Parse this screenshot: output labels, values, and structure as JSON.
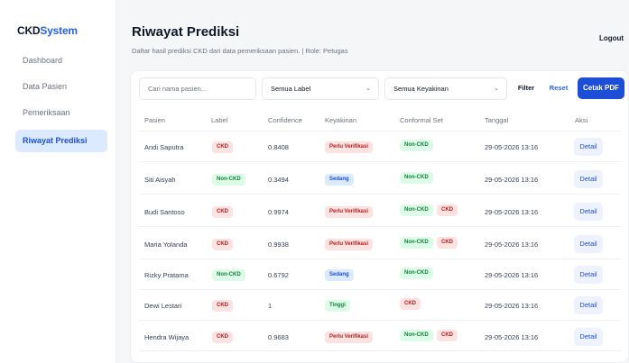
{
  "brand": {
    "part1": "CKD",
    "part2": "System"
  },
  "sidebar": {
    "items": [
      {
        "label": "Dashboard"
      },
      {
        "label": "Data Pasien"
      },
      {
        "label": "Pemeriksaan"
      },
      {
        "label": "Riwayat Prediksi"
      }
    ],
    "active_index": 3
  },
  "header": {
    "title": "Riwayat Prediksi",
    "subtitle": "Daftar hasil prediksi CKD dari data pemeriksaan pasien. | Role: Petugas",
    "logout_label": "Logout"
  },
  "filters": {
    "search_placeholder": "Cari nama pasien...",
    "label_select": "Semua Label",
    "confidence_select": "Semua Keyakinan",
    "chevron": "⌄",
    "filter_label": "Filter",
    "reset_label": "Reset",
    "pdf_label": "Cetak PDF"
  },
  "table": {
    "headers": [
      "Pasien",
      "Label",
      "Confidence",
      "Keyakinan",
      "Conformal Set",
      "Tanggal",
      "Aksi"
    ],
    "detail_label": "Detail",
    "rows": [
      {
        "pasien": "Andi Saputra",
        "label": "CKD",
        "confidence": "0.8408",
        "keyakinan": "Perlu Verifikasi",
        "conformal": [
          "Non-CKD"
        ],
        "tanggal": "29-05-2026 13:16"
      },
      {
        "pasien": "Siti Aisyah",
        "label": "Non-CKD",
        "confidence": "0.3494",
        "keyakinan": "Sedang",
        "conformal": [
          "Non-CKD"
        ],
        "tanggal": "29-05-2026 13:16"
      },
      {
        "pasien": "Budi Santoso",
        "label": "CKD",
        "confidence": "0.9974",
        "keyakinan": "Perlu Verifikasi",
        "conformal": [
          "Non-CKD",
          "CKD"
        ],
        "tanggal": "29-05-2026 13:16"
      },
      {
        "pasien": "Maria Yolanda",
        "label": "CKD",
        "confidence": "0.9938",
        "keyakinan": "Perlu Verifikasi",
        "conformal": [
          "Non-CKD",
          "CKD"
        ],
        "tanggal": "29-05-2026 13:16"
      },
      {
        "pasien": "Rizky Pratama",
        "label": "Non-CKD",
        "confidence": "0.6792",
        "keyakinan": "Sedang",
        "conformal": [
          "Non-CKD"
        ],
        "tanggal": "29-05-2026 13:16"
      },
      {
        "pasien": "Dewi Lestari",
        "label": "CKD",
        "confidence": "1",
        "keyakinan": "Tinggi",
        "conformal": [
          "CKD"
        ],
        "tanggal": "29-05-2026 13:16"
      },
      {
        "pasien": "Hendra Wijaya",
        "label": "CKD",
        "confidence": "0.9683",
        "keyakinan": "Perlu Verifikasi",
        "conformal": [
          "Non-CKD",
          "CKD"
        ],
        "tanggal": "29-05-2026 13:16"
      }
    ]
  },
  "colors": {
    "accent": "#1d4ed8",
    "ckd": "#b91c1c",
    "non_ckd": "#15803d",
    "sedang": "#1d4ed8"
  }
}
